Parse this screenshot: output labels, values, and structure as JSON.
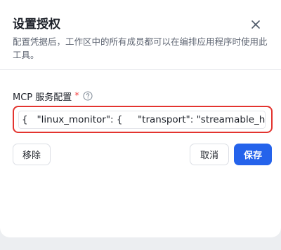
{
  "dialog": {
    "title": "设置授权",
    "description": "配置凭据后，工作区中的所有成员都可以在编排应用程序时使用此工具。",
    "close_icon": "close-icon"
  },
  "mcp_field": {
    "label": "MCP 服务配置",
    "required_mark": "*",
    "help_icon": "question-circle-icon",
    "value": "{   \"linux_monitor\": {     \"transport\": \"streamable_http\""
  },
  "actions": {
    "remove_label": "移除",
    "cancel_label": "取消",
    "save_label": "保存"
  },
  "colors": {
    "primary": "#2563eb",
    "highlight_border": "#e3342f",
    "required": "#f53f3f"
  }
}
